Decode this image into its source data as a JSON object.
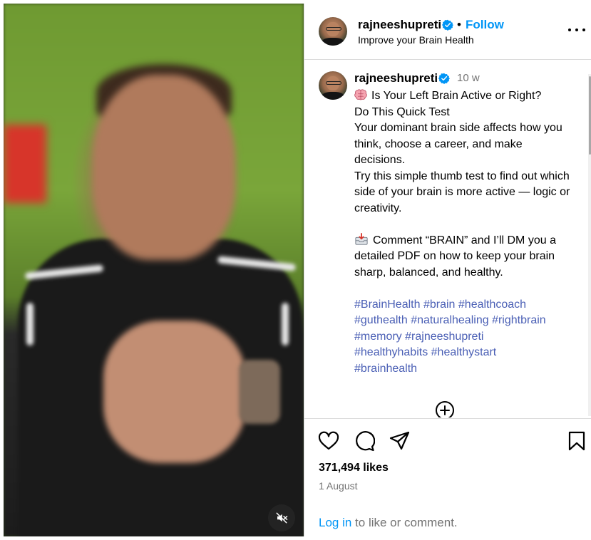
{
  "header": {
    "username": "rajneeshupreti",
    "separator": "•",
    "follow_label": "Follow",
    "subtitle": "Improve your Brain Health"
  },
  "post": {
    "username": "rajneeshupreti",
    "time_ago": "10 w",
    "caption": {
      "line1": "Is Your Left Brain Active or Right?",
      "line2": "Do This Quick Test",
      "line3": "Your dominant brain side affects how you think, choose a career, and make decisions.",
      "line4": "Try this simple thumb test to find out which side of your brain is more active — logic or creativity.",
      "line5": "Comment “BRAIN” and I’ll DM you a detailed PDF on how to keep your brain sharp, balanced, and healthy."
    },
    "hashtags": [
      "#BrainHealth",
      "#brain",
      "#healthcoach",
      "#guthealth",
      "#naturalhealing",
      "#rightbrain",
      "#memory",
      "#rajneeshupreti",
      "#healthyhabits",
      "#healthystart",
      "#brainhealth"
    ]
  },
  "stats": {
    "likes": "371,494 likes",
    "date": "1 August"
  },
  "footer": {
    "login_link": "Log in",
    "login_rest": " to like or comment."
  },
  "icons": {
    "verified": "verified-badge-icon",
    "more": "more-options-icon",
    "like": "heart-icon",
    "comment": "comment-icon",
    "share": "share-icon",
    "save": "bookmark-icon",
    "mute": "muted-speaker-icon",
    "load_more": "plus-circle-icon"
  },
  "colors": {
    "accent": "#0095f6",
    "hashtag": "#4a5fb5",
    "muted_text": "#737373",
    "divider": "#dbdbdb"
  }
}
